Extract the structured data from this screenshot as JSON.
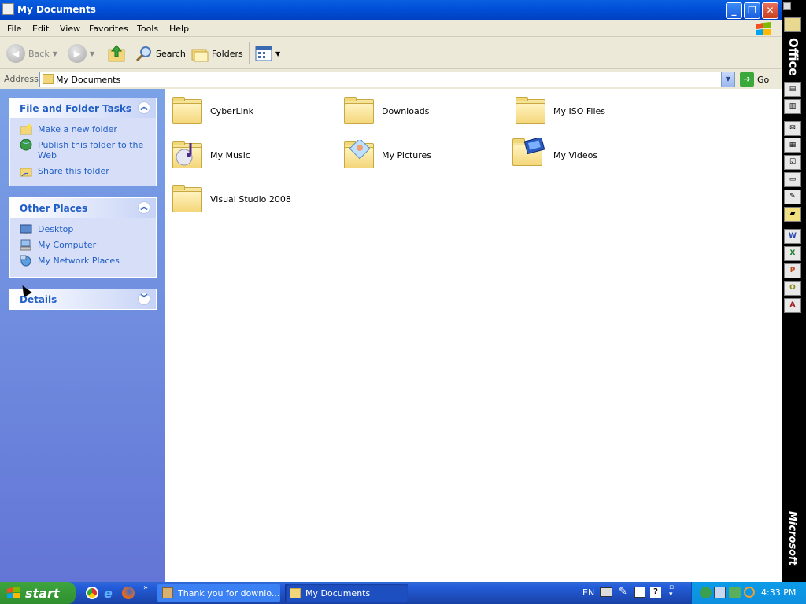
{
  "window": {
    "title": "My Documents",
    "minimize_label": "_",
    "maximize_label": "❐",
    "close_label": "✕"
  },
  "menu": [
    "File",
    "Edit",
    "View",
    "Favorites",
    "Tools",
    "Help"
  ],
  "toolbar": {
    "back_label": "Back",
    "search_label": "Search",
    "folders_label": "Folders"
  },
  "address": {
    "label": "Address",
    "value": "My Documents",
    "go_label": "Go"
  },
  "panels": {
    "file_tasks": {
      "title": "File and Folder Tasks",
      "items": [
        "Make a new folder",
        "Publish this folder to the Web",
        "Share this folder"
      ]
    },
    "other_places": {
      "title": "Other Places",
      "items": [
        "Desktop",
        "My Computer",
        "My Network Places"
      ]
    },
    "details": {
      "title": "Details"
    }
  },
  "files": [
    {
      "name": "CyberLink",
      "icon": "folder-icon"
    },
    {
      "name": "Downloads",
      "icon": "folder-icon"
    },
    {
      "name": "My ISO Files",
      "icon": "folder-icon"
    },
    {
      "name": "My Music",
      "icon": "music-folder-icon"
    },
    {
      "name": "My Pictures",
      "icon": "pictures-folder-icon"
    },
    {
      "name": "My Videos",
      "icon": "videos-folder-icon"
    },
    {
      "name": "Visual Studio 2008",
      "icon": "folder-icon"
    }
  ],
  "office_bar": {
    "top_label": "Office",
    "bottom_label": "Microsoft"
  },
  "taskbar": {
    "start_label": "start",
    "tasks": [
      "Thank you for downlo...",
      "My Documents"
    ],
    "language": "EN",
    "clock": "4:33 PM"
  },
  "colors": {
    "title_blue": "#0050d8",
    "panel_text": "#215dc6",
    "taskbar_blue": "#245edb",
    "start_green": "#2f8f2f"
  }
}
